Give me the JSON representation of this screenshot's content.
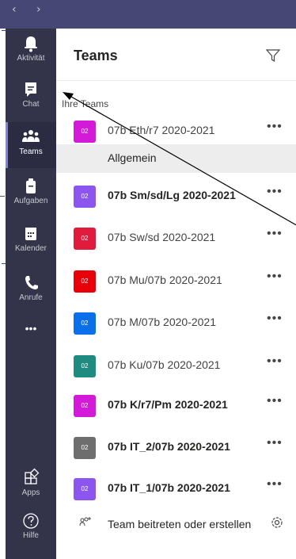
{
  "nav": {
    "back_glyph": "‹",
    "forward_glyph": "›"
  },
  "rail": {
    "items": [
      {
        "label": "Aktivität",
        "icon": "bell-icon"
      },
      {
        "label": "Chat",
        "icon": "chat-icon"
      },
      {
        "label": "Teams",
        "icon": "teams-icon"
      },
      {
        "label": "Aufgaben",
        "icon": "assignments-icon"
      },
      {
        "label": "Kalender",
        "icon": "calendar-icon"
      },
      {
        "label": "Anrufe",
        "icon": "phone-icon"
      }
    ],
    "more_glyph": "•••",
    "apps_label": "Apps",
    "help_label": "Hilfe"
  },
  "panel": {
    "title": "Teams",
    "section_label": "Ihre Teams",
    "channel": "Allgemein",
    "more_glyph": "•••",
    "teams": [
      {
        "name": "07b Eth/r7 2020-2021",
        "tile": "02",
        "color": "#d21ad8",
        "bold": false
      },
      {
        "name": "07b Sm/sd/Lg 2020-2021",
        "tile": "02",
        "color": "#8c55f0",
        "bold": true
      },
      {
        "name": "07b Sw/sd 2020-2021",
        "tile": "02",
        "color": "#e01b3c",
        "bold": false
      },
      {
        "name": "07b Mu/07b 2020-2021",
        "tile": "02",
        "color": "#e8000b",
        "bold": false
      },
      {
        "name": "07b M/07b 2020-2021",
        "tile": "02",
        "color": "#0a6fe8",
        "bold": false
      },
      {
        "name": "07b Ku/07b 2020-2021",
        "tile": "02",
        "color": "#1e8a80",
        "bold": false
      },
      {
        "name": "07b K/r7/Pm 2020-2021",
        "tile": "02",
        "color": "#d21ad8",
        "bold": true
      },
      {
        "name": "07b IT_2/07b 2020-2021",
        "tile": "02",
        "color": "#6e6e6e",
        "bold": true
      },
      {
        "name": "07b IT_1/07b 2020-2021",
        "tile": "02",
        "color": "#8c55f0",
        "bold": true
      }
    ]
  },
  "footer": {
    "join_text": "Team beitreten oder erstellen"
  },
  "colors": {
    "topbar": "#464775",
    "rail": "#33344a",
    "accent": "#7b83eb"
  }
}
